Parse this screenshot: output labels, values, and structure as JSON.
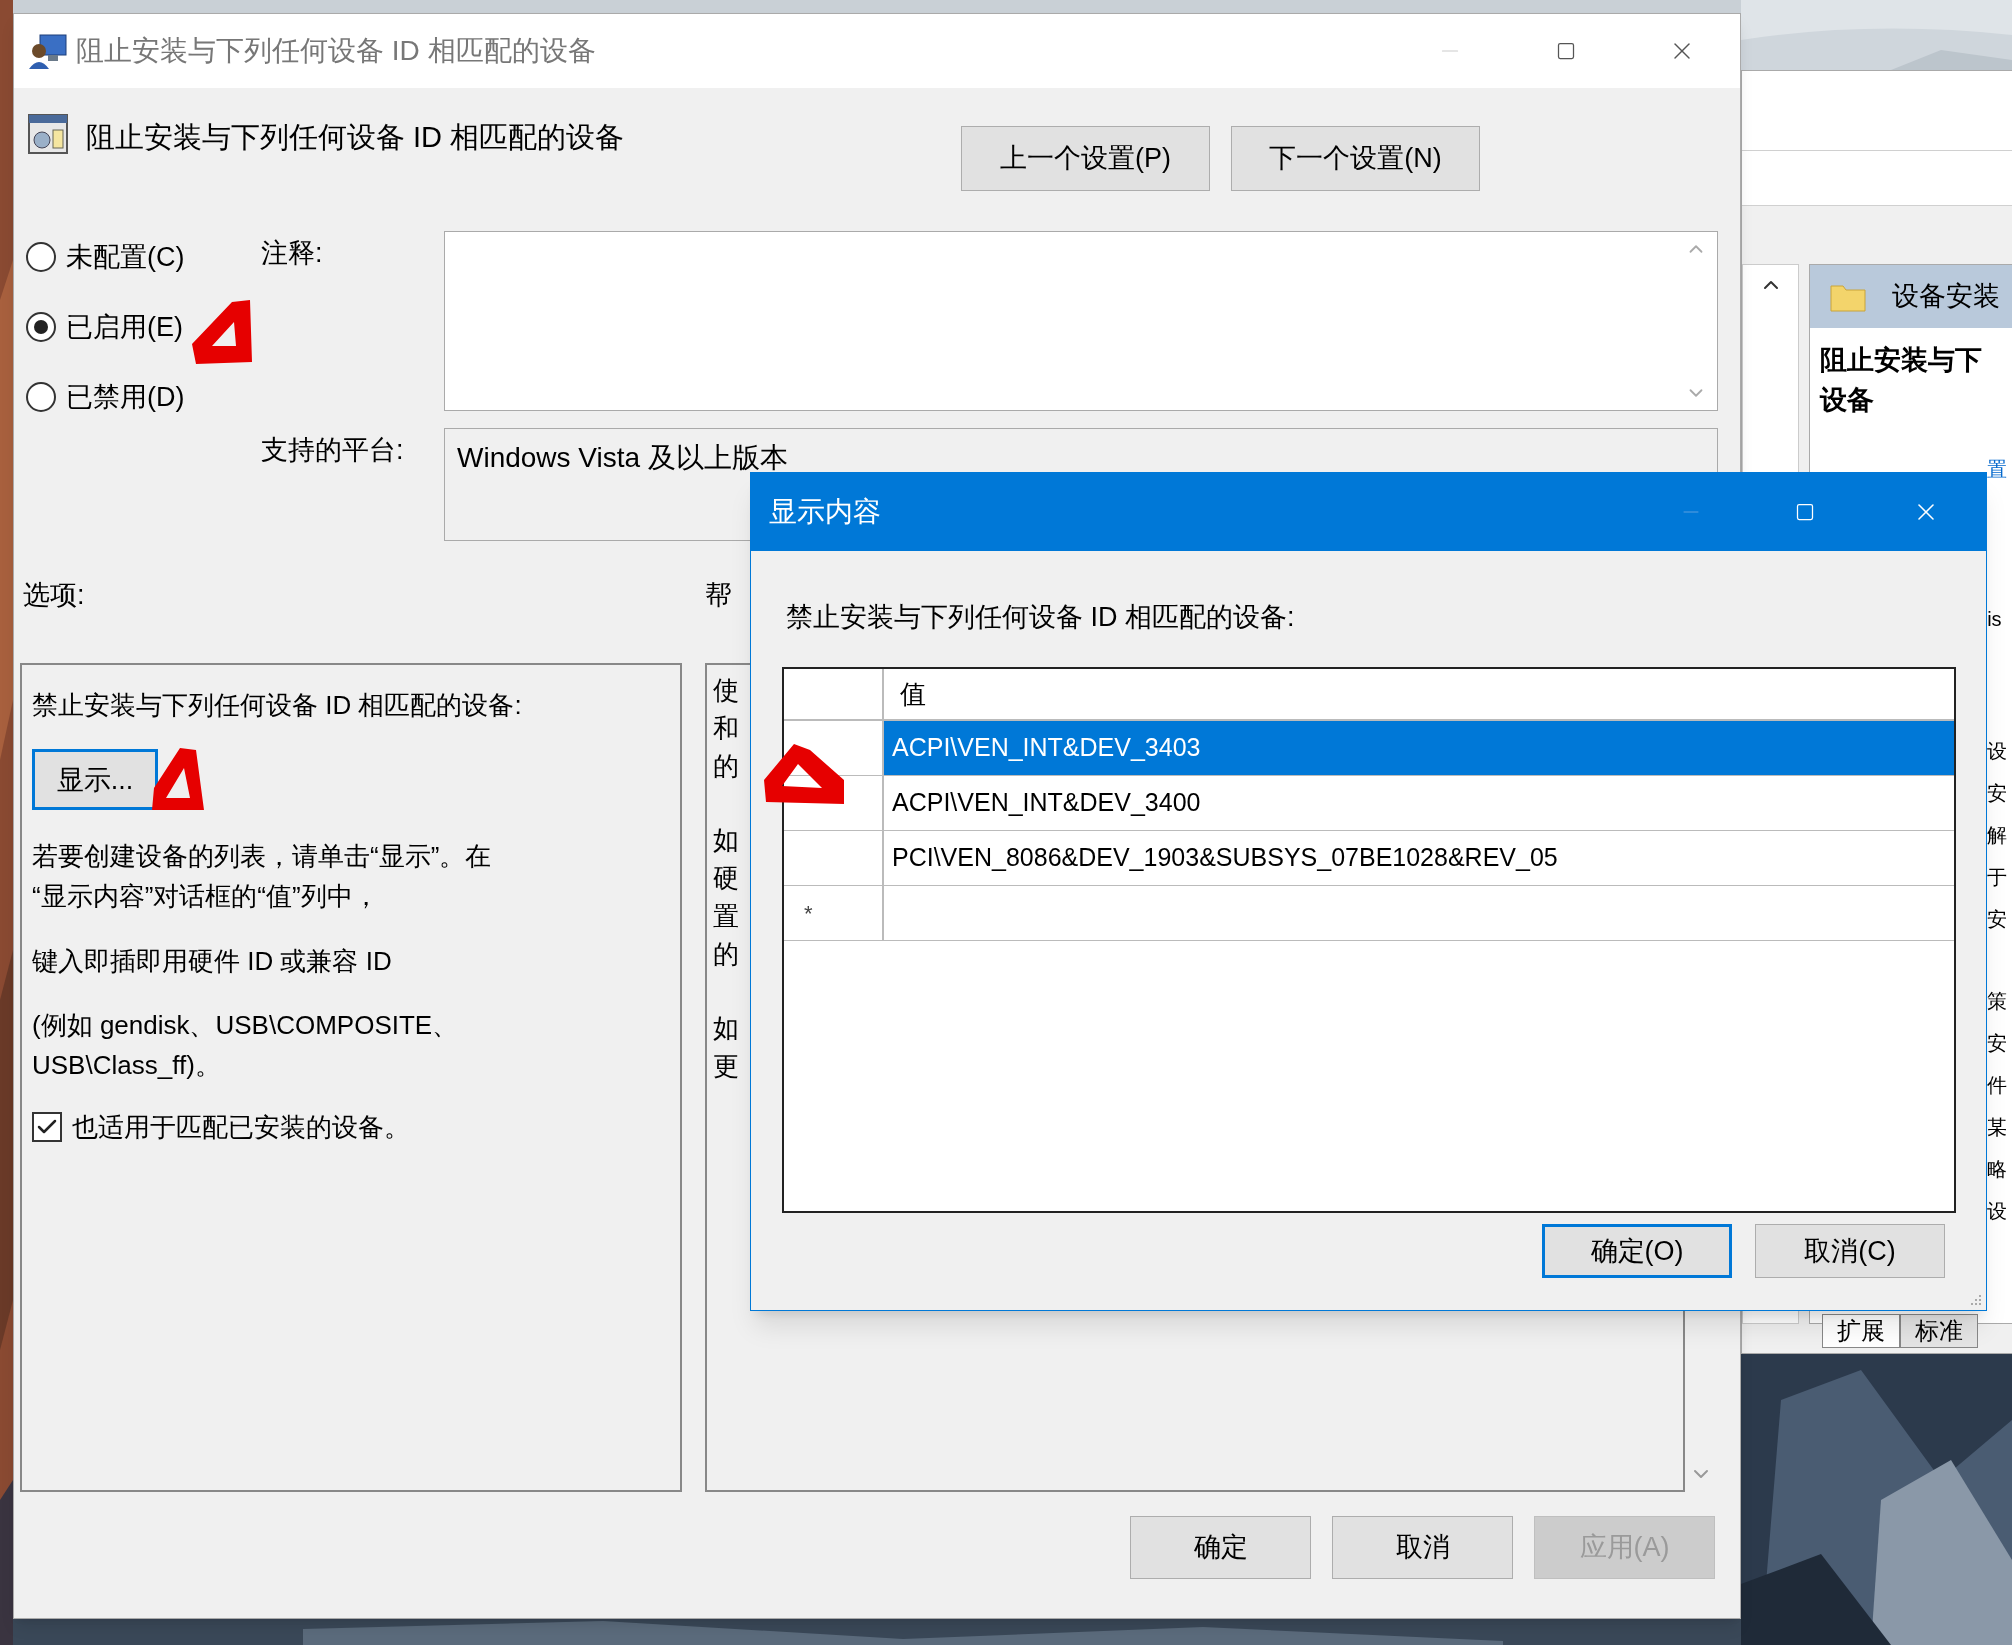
{
  "main_window": {
    "title": "阻止安装与下列任何设备 ID 相匹配的设备",
    "policy_title": "阻止安装与下列任何设备 ID 相匹配的设备",
    "nav_buttons": [
      "上一个设置(P)",
      "下一个设置(N)"
    ],
    "states": [
      {
        "label": "未配置(C)",
        "selected": false
      },
      {
        "label": "已启用(E)",
        "selected": true
      },
      {
        "label": "已禁用(D)",
        "selected": false
      }
    ],
    "comment_label": "注释:",
    "platform_label": "支持的平台:",
    "platform_value": "Windows Vista 及以上版本",
    "options_label": "选项:",
    "help_label": "帮",
    "options": {
      "prompt": "禁止安装与下列任何设备 ID 相匹配的设备:",
      "show_button": {
        "label": "显示...",
        "focused": true
      },
      "instructions": "若要创建设备的列表，请单击“显示”。在\n“显示内容”对话框的“值”列中，",
      "hint": "键入即插即用硬件 ID 或兼容 ID",
      "example": "(例如 gendisk、USB\\COMPOSITE、\nUSB\\Class_ff)。",
      "checkbox": {
        "label": "也适用于匹配已安装的设备。",
        "checked": true
      }
    },
    "help_paragraphs": [
      [
        "使",
        "和",
        "的"
      ],
      [
        "如",
        "硬",
        "置",
        "的"
      ],
      [
        "如",
        "更"
      ]
    ],
    "buttons": [
      {
        "label": "确定",
        "disabled": false
      },
      {
        "label": "取消",
        "disabled": false
      },
      {
        "label": "应用(A)",
        "disabled": true
      }
    ]
  },
  "background_window": {
    "section_title": "设备安装",
    "policy_title": [
      "阻止安装与下",
      "设备"
    ],
    "link_fragment": "置",
    "text_fragment": "is",
    "char_columns": [
      [
        "设",
        "安",
        "解",
        "于",
        "安"
      ],
      [
        "策",
        "安",
        "件",
        "某",
        "略",
        "设"
      ]
    ],
    "tabs": [
      {
        "label": "扩展",
        "selected": true
      },
      {
        "label": "标准",
        "selected": false
      }
    ]
  },
  "dialog": {
    "title": "显示内容",
    "prompt": "禁止安装与下列任何设备 ID 相匹配的设备:",
    "column_header": "值",
    "rows": [
      {
        "value": "ACPI\\VEN_INT&DEV_3403",
        "selected": true
      },
      {
        "value": "ACPI\\VEN_INT&DEV_3400",
        "selected": false
      },
      {
        "value": "PCI\\VEN_8086&DEV_1903&SUBSYS_07BE1028&REV_05",
        "selected": false
      }
    ],
    "new_row_marker": "*",
    "buttons": [
      {
        "label": "确定(O)",
        "default": true
      },
      {
        "label": "取消(C)",
        "default": false
      }
    ]
  }
}
